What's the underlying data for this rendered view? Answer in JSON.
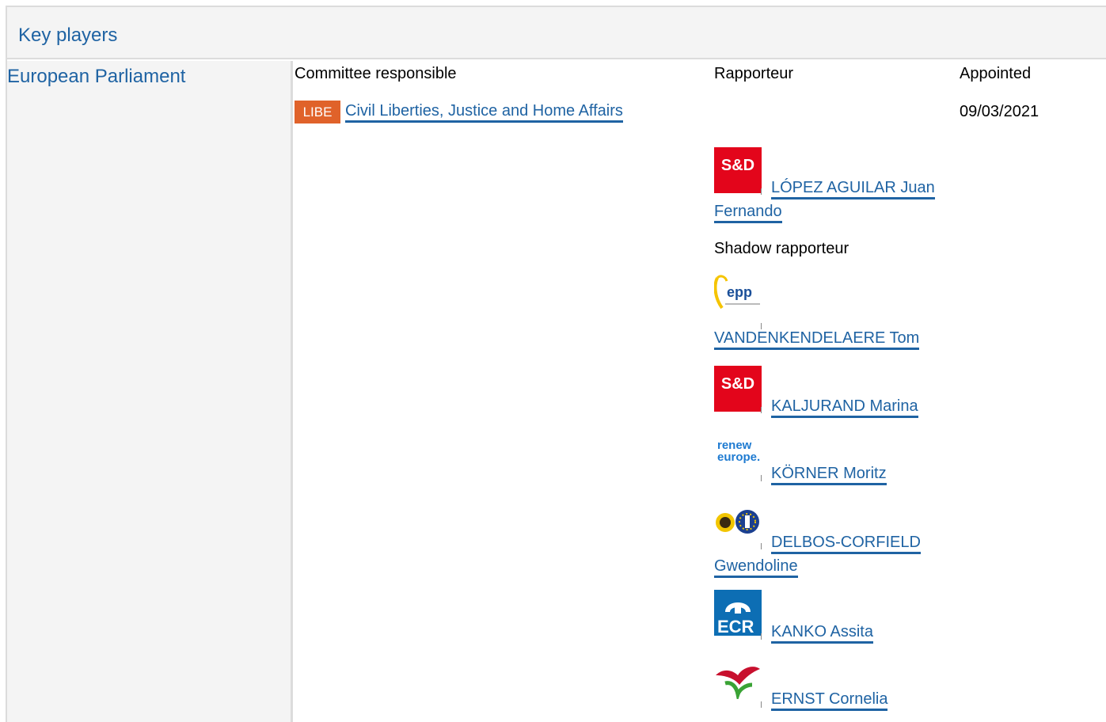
{
  "section": {
    "title": "Key players"
  },
  "institution": {
    "name": "European Parliament"
  },
  "columns": {
    "committee": "Committee responsible",
    "rapporteur": "Rapporteur",
    "appointed": "Appointed"
  },
  "committee": {
    "code": "LIBE",
    "name": "Civil Liberties, Justice and Home Affairs",
    "appointed_date": "09/03/2021"
  },
  "rapporteur": {
    "group_logo": "S&D",
    "name": "LÓPEZ AGUILAR Juan Fernando"
  },
  "shadow": {
    "label": "Shadow rapporteur",
    "members": [
      {
        "logo": "epp",
        "name": "VANDENKENDELAERE Tom"
      },
      {
        "logo": "S&D",
        "name": "KALJURAND Marina"
      },
      {
        "logo": "renew europe.",
        "logo_line1": "renew",
        "logo_line2": "europe.",
        "name": "KÖRNER Moritz"
      },
      {
        "logo": "greens-efa-icon",
        "name": "DELBOS-CORFIELD Gwendoline"
      },
      {
        "logo": "ECR",
        "name": "KANKO Assita"
      },
      {
        "logo": "gue-ngl-icon",
        "name": "ERNST Cornelia"
      }
    ]
  },
  "colors": {
    "link": "#1f63a3",
    "badge": "#e0622a",
    "sd_red": "#e3051b",
    "ecr_blue": "#0d6eb4",
    "panel_bg": "#f4f4f4"
  }
}
